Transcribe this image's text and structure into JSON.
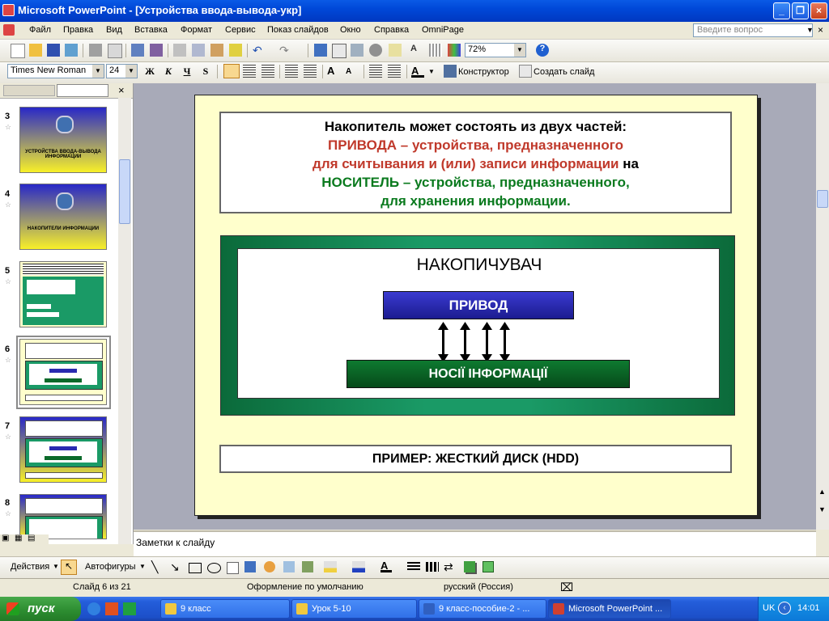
{
  "window": {
    "app_name": "Microsoft PowerPoint",
    "title": "Microsoft PowerPoint - [Устройства ввода-вывода-укр]"
  },
  "menu": {
    "items": [
      "Файл",
      "Правка",
      "Вид",
      "Вставка",
      "Формат",
      "Сервис",
      "Показ слайдов",
      "Окно",
      "Справка",
      "OmniPage"
    ],
    "help_placeholder": "Введите вопрос"
  },
  "standard_toolbar": {
    "zoom": "72%"
  },
  "format_toolbar": {
    "font": "Times New Roman",
    "size": "24",
    "bold": "Ж",
    "italic": "К",
    "underline": "Ч",
    "shadow": "S",
    "designer": "Конструктор",
    "new_slide": "Создать слайд"
  },
  "slides_panel": {
    "thumbnails": [
      {
        "num": "3",
        "caption": "УСТРОЙСТВА ВВОДА-ВЫВОДА ИНФОРМАЦИИ"
      },
      {
        "num": "4",
        "caption": "НАКОПИТЕЛИ ИНФОРМАЦИИ"
      },
      {
        "num": "5",
        "caption": ""
      },
      {
        "num": "6",
        "caption": ""
      },
      {
        "num": "7",
        "caption": ""
      },
      {
        "num": "8",
        "caption": ""
      }
    ]
  },
  "slide": {
    "heading_line1": "Накопитель может состоять из двух частей:",
    "heading_line2": "ПРИВОДА – устройства, предназначенного",
    "heading_line3a": "для считывания и (или) записи информации",
    "heading_line3b": " на",
    "heading_line4": "НОСИТЕЛЬ – устройства, предназначенного,",
    "heading_line5": "для хранения информации.",
    "diagram_title": "НАКОПИЧУВАЧ",
    "drive_label": "ПРИВОД",
    "media_label": "НОСІЇ ІНФОРМАЦІЇ",
    "example": "ПРИМЕР: ЖЕСТКИЙ ДИСК (HDD)",
    "colors": {
      "red": "#c0392b",
      "green": "#0a7a1e",
      "drive": "#2a2ab0",
      "media": "#0b6a2a"
    }
  },
  "notes": {
    "placeholder": "Заметки к слайду"
  },
  "drawing_toolbar": {
    "actions": "Действия",
    "autoshapes": "Автофигуры"
  },
  "status": {
    "slide_info": "Слайд 6 из 21",
    "design": "Оформление по умолчанию",
    "language": "русский (Россия)"
  },
  "taskbar": {
    "start": "пуск",
    "tasks": [
      "9 класс",
      "Урок  5-10",
      "9 класс-пособие-2 - ...",
      "Microsoft PowerPoint ..."
    ],
    "lang": "UK",
    "clock": "14:01"
  }
}
